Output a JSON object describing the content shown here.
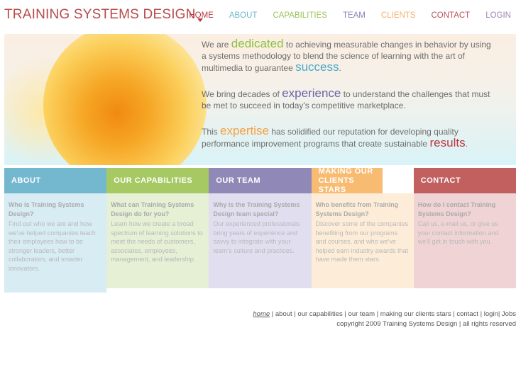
{
  "header": {
    "logo": "TRAINING SYSTEMS DESIGN",
    "nav": [
      {
        "label": "HOME",
        "color": "#b8393f"
      },
      {
        "label": "ABOUT",
        "color": "#6fb6cf"
      },
      {
        "label": "CAPABILITIES",
        "color": "#9cc35a"
      },
      {
        "label": "TEAM",
        "color": "#8a84b5"
      },
      {
        "label": "CLIENTS",
        "color": "#f6b46c"
      },
      {
        "label": "CONTACT",
        "color": "#b9525a"
      },
      {
        "label": "LOGIN",
        "color": "#a184b8"
      }
    ]
  },
  "hero": {
    "p1": {
      "a": "We are ",
      "w1": "dedicated",
      "b": " to achieving measurable changes in behavior by using a systems methodology to blend the science of learning with the art of multimedia to guarantee ",
      "w2": "success",
      "c": "."
    },
    "p2": {
      "a": "We bring decades of ",
      "w1": "experience",
      "b": " to understand the challenges that must be met to succeed in today's competitive marketplace."
    },
    "p3": {
      "a": "This ",
      "w1": "expertise",
      "b": " has solidified our reputation for developing quality performance improvement programs that create sustainable ",
      "w2": "results",
      "c": "."
    }
  },
  "cards": [
    {
      "title": "ABOUT",
      "question": "Who is Training Systems Design?",
      "text": "Find out who we are and how we've helped companies teach their employees how to be stronger leaders, better collaborators, and smarter innovators.",
      "head": "#74b8d0",
      "body": "#d8ecf3"
    },
    {
      "title": "OUR CAPABILITIES",
      "question": "What can Training Systems Design do for you?",
      "text": "Learn how we create a broad spectrum of learning solutions to meet the needs of customers, associates, employees, management, and leadership.",
      "head": "#a6c964",
      "body": "#e5f0d5"
    },
    {
      "title": "OUR TEAM",
      "question": "Why is the Training Systems Design team special?",
      "text": "Our experienced professionals bring years of experience and savvy to integrate with your team's culture and practices.",
      "head": "#9089b8",
      "body": "#e1def0"
    },
    {
      "title": "MAKING OUR CLIENTS STARS",
      "question": "Who benefits from Training Systems Design?",
      "text": "Discover some of the companies benefiting from our programs and courses, and who we've helped earn industry awards that have made them stars.",
      "head": "#f7bb72",
      "body": "#fdedd8"
    },
    {
      "title": "CONTACT",
      "question": "How do I contact Training Systems Design?",
      "text": "Call us, e-mail us, or give us your contact information and we'll get in touch with you.",
      "head": "#c26060",
      "body": "#f0d3d5"
    }
  ],
  "footer": {
    "links": [
      "home",
      "about",
      "our capabilities",
      "our team",
      "making our clients stars",
      "contact",
      "login",
      "Jobs"
    ],
    "copyright": "copyright 2009 Training Systems Design | all rights reserved"
  }
}
